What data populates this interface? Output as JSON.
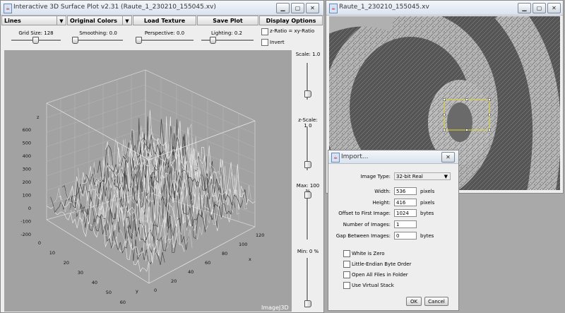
{
  "plot_window": {
    "title": "Interactive 3D Surface Plot v2.31  (Raute_1_230210_155045.xv)",
    "toolbar": {
      "style_select": "Lines",
      "color_select": "Original Colors",
      "load_texture": "Load Texture",
      "save_plot": "Save Plot",
      "display_options": "Display Options"
    },
    "sliders": {
      "grid_size": "Grid Size: 128",
      "smoothing": "Smoothing: 0.0",
      "perspective": "Perspective: 0.0",
      "lighting": "Lighting: 0.2"
    },
    "checkboxes": {
      "z_ratio": "z-Ratio = xy-Ratio",
      "invert": "Invert"
    },
    "side_sliders": {
      "scale": "Scale: 1.0",
      "z_scale": "z-Scale: 1.0",
      "max": "Max: 100 %",
      "min": "Min: 0 %"
    },
    "plot": {
      "z_axis_label": "z",
      "z_ticks": [
        "600",
        "500",
        "400",
        "300",
        "200",
        "100",
        "0",
        "-100",
        "-200"
      ],
      "y_ticks": [
        "0",
        "10",
        "20",
        "30",
        "40",
        "50",
        "60"
      ],
      "y_axis_label": "y",
      "x_ticks": [
        "0",
        "20",
        "40",
        "60",
        "80",
        "100",
        "120"
      ],
      "x_axis_label": "x",
      "watermark": "ImageJ3D"
    }
  },
  "image_window": {
    "title": "Raute_1_230210_155045.xv"
  },
  "import_dialog": {
    "title": "Import...",
    "image_type_label": "Image Type:",
    "image_type_value": "32-bit Real",
    "width_label": "Width:",
    "width_value": "536",
    "width_unit": "pixels",
    "height_label": "Height:",
    "height_value": "416",
    "height_unit": "pixels",
    "offset_label": "Offset to First Image:",
    "offset_value": "1024",
    "offset_unit": "bytes",
    "num_images_label": "Number of Images:",
    "num_images_value": "1",
    "gap_label": "Gap Between Images:",
    "gap_value": "0",
    "gap_unit": "bytes",
    "options": [
      "White is Zero",
      "Little-Endian Byte Order",
      "Open All Files in Folder",
      "Use Virtual Stack"
    ],
    "ok": "OK",
    "cancel": "Cancel"
  }
}
